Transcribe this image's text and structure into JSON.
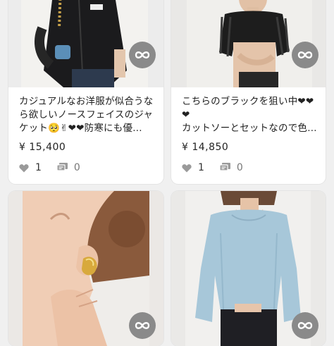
{
  "items": [
    {
      "title_lines": [
        "カジュアルなお洋服が似合うな",
        "ら欲しいノースフェイスのジャ",
        "ケット🥺✌❤❤防寒にも優…"
      ],
      "price": "¥ 15,400",
      "likes": "1",
      "comments": "0"
    },
    {
      "title_lines": [
        "こちらのブラックを狙い中❤❤",
        "❤",
        "カットソーとセットなので色…"
      ],
      "price": "¥ 14,850",
      "likes": "1",
      "comments": "0"
    },
    {
      "title_lines": [],
      "price": "",
      "likes": "",
      "comments": ""
    },
    {
      "title_lines": [],
      "price": "",
      "likes": "",
      "comments": ""
    }
  ],
  "colors": {
    "badge": "#8a8a8a",
    "background": "#f0f0f0",
    "card": "#ffffff",
    "icon": "#9a9a9a"
  },
  "icons": [
    "infinity-icon",
    "heart-icon",
    "comment-icon"
  ]
}
